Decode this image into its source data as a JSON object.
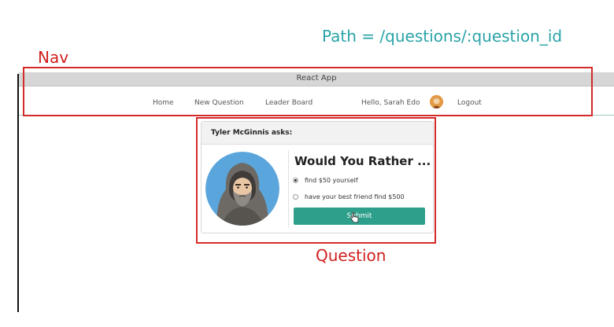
{
  "annotations": {
    "path": "Path = /questions/:question_id",
    "nav": "Nav",
    "question": "Question"
  },
  "window": {
    "title": "React App"
  },
  "nav": {
    "home": "Home",
    "new_question": "New Question",
    "leader_board": "Leader Board",
    "greeting": "Hello, Sarah Edo",
    "logout": "Logout"
  },
  "question": {
    "author_header": "Tyler McGinnis asks:",
    "title": "Would You Rather ...",
    "options": [
      {
        "label": "find $50 yourself",
        "selected": true
      },
      {
        "label": "have your best friend find $500",
        "selected": false
      }
    ],
    "submit_label": "Submit"
  },
  "colors": {
    "annotation_red": "#d0201f",
    "path_teal": "#2aa3a8",
    "submit_green": "#2e9f8b"
  }
}
